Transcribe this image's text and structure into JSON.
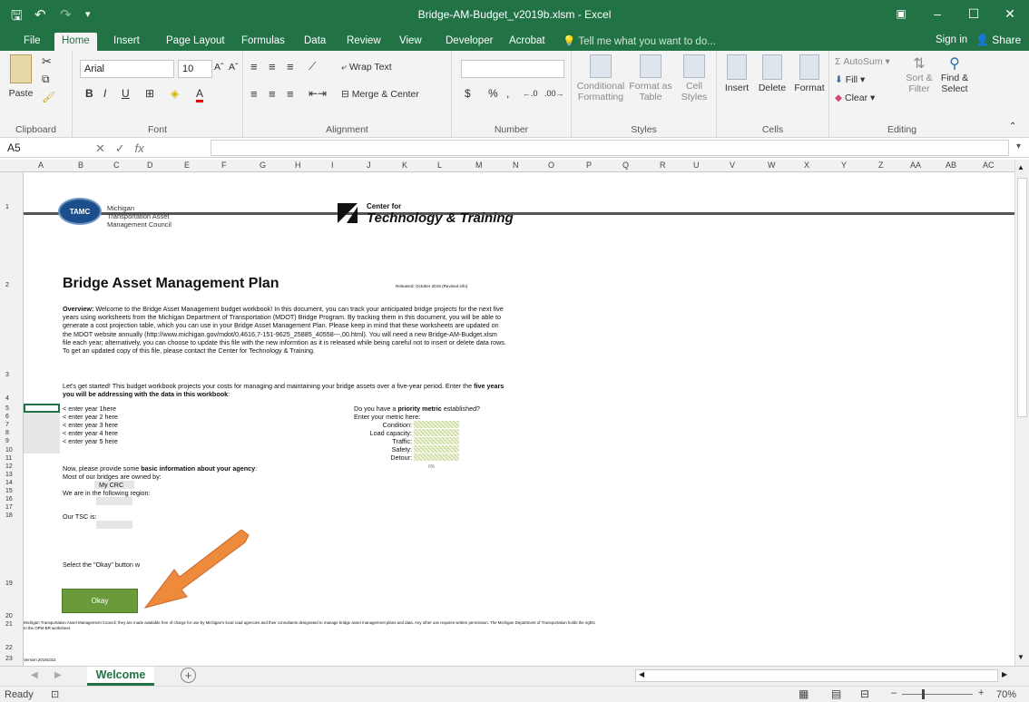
{
  "window": {
    "title": "Bridge-AM-Budget_v2019b.xlsm - Excel",
    "restore_icon": "ribbon-display-options-icon",
    "minimize": "–",
    "maximize": "☐",
    "close": "✕"
  },
  "quick_access": {
    "save_icon": "save-icon",
    "undo_icon": "undo-icon",
    "redo_icon": "redo-icon"
  },
  "tabs": [
    "File",
    "Home",
    "Insert",
    "Page Layout",
    "Formulas",
    "Data",
    "Review",
    "View",
    "Developer",
    "Acrobat"
  ],
  "tell_me": "Tell me what you want to do...",
  "sign_in": "Sign in",
  "share": "Share",
  "ribbon": {
    "clipboard": {
      "label": "Clipboard",
      "paste": "Paste"
    },
    "font": {
      "label": "Font",
      "name": "Arial",
      "size": "10",
      "bold": "B",
      "italic": "I",
      "underline": "U",
      "grow": "Aˆ",
      "shrink": "Aˇ",
      "color_letter": "A"
    },
    "alignment": {
      "label": "Alignment",
      "wrap": "Wrap Text",
      "merge": "Merge & Center"
    },
    "number": {
      "label": "Number",
      "currency": "$",
      "percent": "%",
      "comma": ","
    },
    "styles": {
      "label": "Styles",
      "conditional": "Conditional",
      "conditional2": "Formatting",
      "format_as": "Format as",
      "format_as2": "Table",
      "cell": "Cell",
      "cell2": "Styles"
    },
    "cells": {
      "label": "Cells",
      "insert": "Insert",
      "delete": "Delete",
      "format": "Format"
    },
    "editing": {
      "label": "Editing",
      "autosum": "AutoSum",
      "fill": "Fill",
      "clear": "Clear",
      "sort": "Sort &",
      "sort2": "Filter",
      "find": "Find &",
      "find2": "Select"
    }
  },
  "formula_bar": {
    "name_box": "A5",
    "fx": "fx",
    "value": ""
  },
  "columns": [
    "A",
    "B",
    "C",
    "D",
    "E",
    "F",
    "G",
    "H",
    "I",
    "J",
    "K",
    "L",
    "M",
    "N",
    "O",
    "P",
    "Q",
    "R",
    "U",
    "V",
    "W",
    "X",
    "Y",
    "Z",
    "AA",
    "AB",
    "AC"
  ],
  "rows": [
    "1",
    "2",
    "3",
    "4",
    "5",
    "6",
    "7",
    "8",
    "9",
    "10",
    "11",
    "12",
    "13",
    "14",
    "15",
    "16",
    "17",
    "18",
    "19",
    "20",
    "21",
    "22",
    "23"
  ],
  "doc": {
    "tamc_logo": "TAMC",
    "tamc_line1": "Michigan",
    "tamc_line2": "Transportation Asset",
    "tamc_line3": "Management Council",
    "ctt_line1": "Center for",
    "ctt_line2": "Technology & Training",
    "title": "Bridge Asset Management Plan",
    "released": "Released: October 2019 (Revised info)",
    "overview_label": "Overview:",
    "overview_text": "Welcome to the Bridge Asset Management budget workbook! In this document, you can track your anticipated bridge projects for the next five years using worksheets from the Michigan Department of Transportation (MDOT) Bridge Program. By tracking them in this document, you will be able to generate a cost projection table, which you can use in your Bridge Asset Management Plan. Please keep in mind that these worksheets are updated on the MDOT website annually (http://www.michigan.gov/mdot/0,4616,7-151-9625_25885_40558---,00.html). You will need a new Bridge-AM-Budget.xlsm file each year; alternatively, you can choose to update this file with the new informtion as it is released while being careful not to insert or delete data rows. To get an updated copy of this file, please contact the Center for Technology & Training.",
    "started_a": "Let's get started! This budget workbook projects your costs for managing and maintaining your bridge assets over a five-year period. Enter the ",
    "started_b": "five years you will be addressing with the data in this workbook",
    "started_c": ":",
    "years": [
      "< enter year 1here",
      "< enter year 2 here",
      "< enter year 3 here",
      "< enter year 4 here",
      "< enter year 5 here"
    ],
    "priority_a": "Do you have a ",
    "priority_b": "priority metric",
    "priority_c": " established?",
    "metric_prompt": "Enter your metric here:",
    "metrics": [
      "Condition:",
      "Load capacity:",
      "Traffic:",
      "Safety:",
      "Detour:"
    ],
    "metric_sum": "0%",
    "basic_a": "Now, please provide some ",
    "basic_b": "basic information about your agency",
    "basic_c": ":",
    "owned": "Most of our bridges are owned by:",
    "owner_value": "My CRC",
    "region": "We are in the following region:",
    "tsc": "Our TSC is:",
    "select_okay": "Select the \"Okay\" button w",
    "okay": "Okay",
    "footer": "Michigan Transportation Asset Management Council; they are made available free of charge for use by Michigan's local road agencies and their consultants designated to manage bridge asset management plans and data. Any other use requires written permission. The Michigan Department of Transportation holds the rights to the OPM-BR worksheet.",
    "version": "Version 20191022"
  },
  "sheet_tab": "Welcome",
  "add_sheet": "+",
  "status": {
    "ready": "Ready",
    "zoom": "70%"
  }
}
